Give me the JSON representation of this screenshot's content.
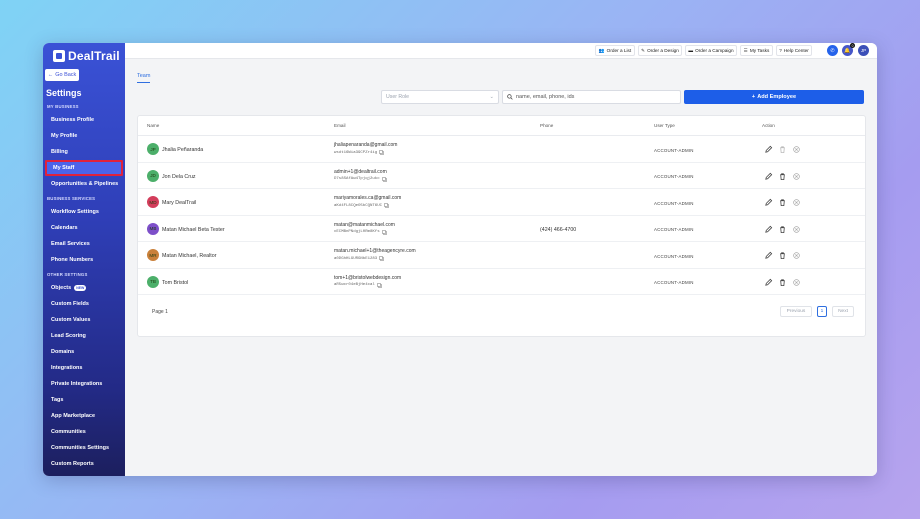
{
  "app": {
    "name": "DealTrail"
  },
  "sidebar": {
    "go_back": "Go Back",
    "title": "Settings",
    "sections": [
      {
        "label": "MY BUSINESS"
      },
      {
        "label": "BUSINESS SERVICES"
      },
      {
        "label": "OTHER SETTINGS"
      }
    ],
    "items": [
      {
        "label": "Business Profile"
      },
      {
        "label": "My Profile"
      },
      {
        "label": "Billing"
      },
      {
        "label": "My Staff",
        "active": true
      },
      {
        "label": "Opportunities & Pipelines"
      },
      {
        "label": "Workflow Settings"
      },
      {
        "label": "Calendars"
      },
      {
        "label": "Email Services"
      },
      {
        "label": "Phone Numbers"
      },
      {
        "label": "Objects",
        "badge": "NEW"
      },
      {
        "label": "Custom Fields"
      },
      {
        "label": "Custom Values"
      },
      {
        "label": "Lead Scoring"
      },
      {
        "label": "Domains"
      },
      {
        "label": "Integrations"
      },
      {
        "label": "Private Integrations"
      },
      {
        "label": "Tags"
      },
      {
        "label": "App Marketplace"
      },
      {
        "label": "Communities"
      },
      {
        "label": "Communities Settings"
      },
      {
        "label": "Custom Reports"
      }
    ]
  },
  "topbar": {
    "buttons": [
      {
        "label": "Order a List",
        "icon": "users-icon"
      },
      {
        "label": "Order a Design",
        "icon": "brush-icon"
      },
      {
        "label": "Order a Campaign",
        "icon": "campaign-icon"
      },
      {
        "label": "My Tasks",
        "icon": "tasks-icon"
      },
      {
        "label": "Help Center",
        "icon": "help-icon"
      }
    ],
    "notification_count": "0",
    "user_initials": "JP"
  },
  "main": {
    "tab": "Team",
    "role_select": {
      "placeholder": "User Role"
    },
    "search": {
      "placeholder": "name, email, phone, ids"
    },
    "add_button": "Add Employee",
    "columns": [
      "Name",
      "Email",
      "Phone",
      "User Type",
      "Action"
    ],
    "rows": [
      {
        "initials": "JP",
        "name": "Jhalia Peñaranda",
        "email": "jhaliapenaranda@gmail.com",
        "id": "wsdt16Wia39CPZr4ig",
        "phone": "",
        "user_type": "ACCOUNT-ADMIN",
        "avatar_color": "#4caf6a"
      },
      {
        "initials": "JD",
        "name": "Jon Dela Cruz",
        "email": "admin+1@dealtrail.com",
        "id": "D7s8SAfAw4Tpjqj2ukc",
        "phone": "",
        "user_type": "ACCOUNT-ADMIN",
        "avatar_color": "#4caf6a"
      },
      {
        "initials": "MD",
        "name": "Mary DealTrail",
        "email": "mariyamorales.ca@gmail.com",
        "id": "aKd4FL8CQeO5bCQNT6UC",
        "phone": "",
        "user_type": "ACCOUNT-ADMIN",
        "avatar_color": "#d33d5b"
      },
      {
        "initials": "MB",
        "name": "Matan Michael Beta Tester",
        "email": "matan@matanmichael.com",
        "id": "cECMBnPNdgjL0Rm8Kfs",
        "phone": "(424) 466-4700",
        "user_type": "ACCOUNT-ADMIN",
        "avatar_color": "#7d4fc9"
      },
      {
        "initials": "MR",
        "name": "Matan Michael, Realtor",
        "email": "matan.michael+1@theagencyre.com",
        "id": "a0DGhHLGURGNbE1283",
        "phone": "",
        "user_type": "ACCOUNT-ADMIN",
        "avatar_color": "#c9803a"
      },
      {
        "initials": "TB",
        "name": "Tom Bristol",
        "email": "tom+1@bristolwebdesign.com",
        "id": "aR5wcr04eBjHe4cal",
        "phone": "",
        "user_type": "ACCOUNT-ADMIN",
        "avatar_color": "#4caf6a"
      }
    ],
    "pagination": {
      "page_label": "Page 1",
      "previous": "Previous",
      "current": "1",
      "next": "Next"
    }
  },
  "colors": {
    "accent": "#1d5ee8",
    "sidebar": "#2f3fb8",
    "highlight_box": "#e0223b"
  }
}
